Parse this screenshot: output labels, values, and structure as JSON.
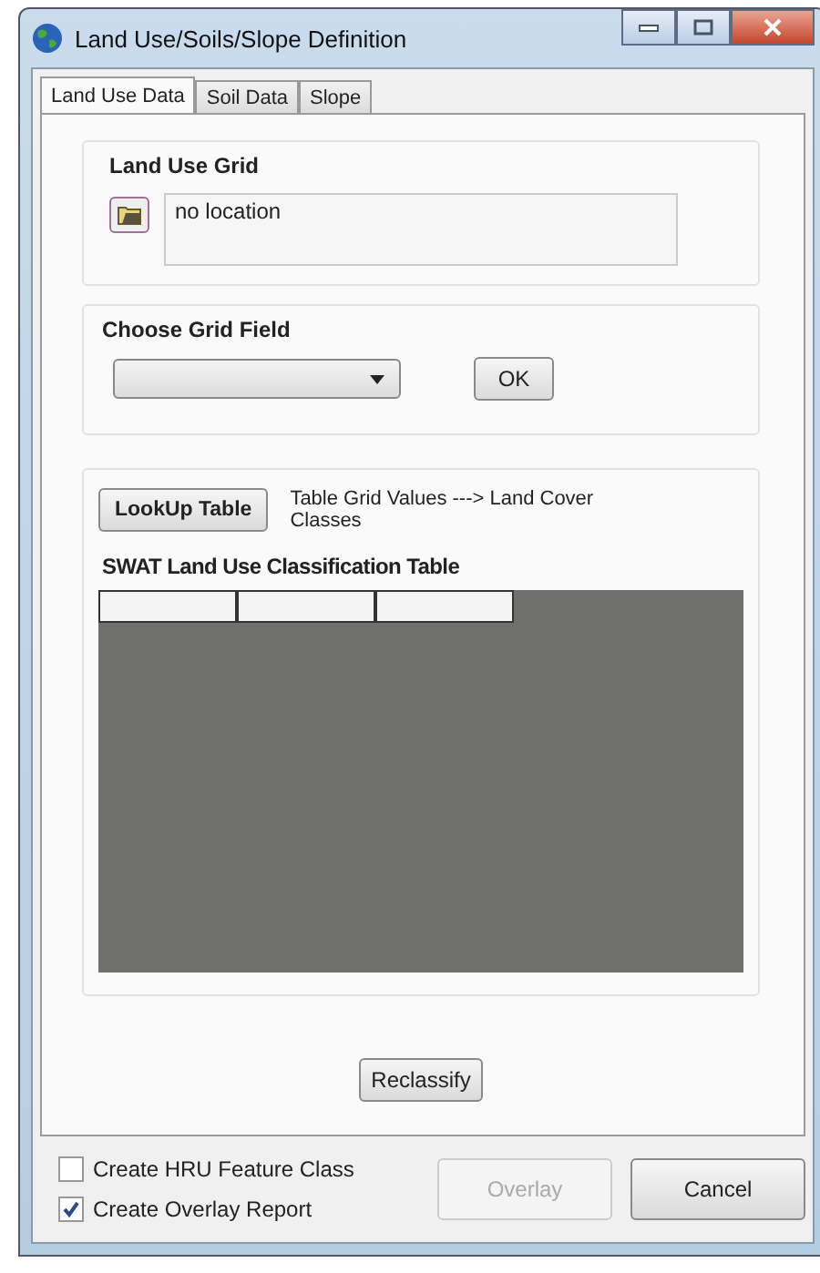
{
  "window": {
    "title": "Land Use/Soils/Slope Definition"
  },
  "tabs": [
    {
      "label": "Land Use Data",
      "selected": true
    },
    {
      "label": "Soil Data",
      "selected": false
    },
    {
      "label": "Slope",
      "selected": false
    }
  ],
  "land_use_grid": {
    "title": "Land Use Grid",
    "location": "no location"
  },
  "grid_field": {
    "title": "Choose Grid Field",
    "ok_button": "OK"
  },
  "lookup": {
    "button": "LookUp Table",
    "description": "Table Grid Values ---> Land Cover Classes",
    "table_title": "SWAT Land Use Classification Table"
  },
  "reclassify_button": "Reclassify",
  "options": [
    {
      "label": "Create HRU Feature Class",
      "checked": false
    },
    {
      "label": "Create Overlay Report",
      "checked": true
    }
  ],
  "buttons": [
    {
      "label": "Overlay",
      "disabled": true
    },
    {
      "label": "Cancel",
      "disabled": false
    }
  ]
}
